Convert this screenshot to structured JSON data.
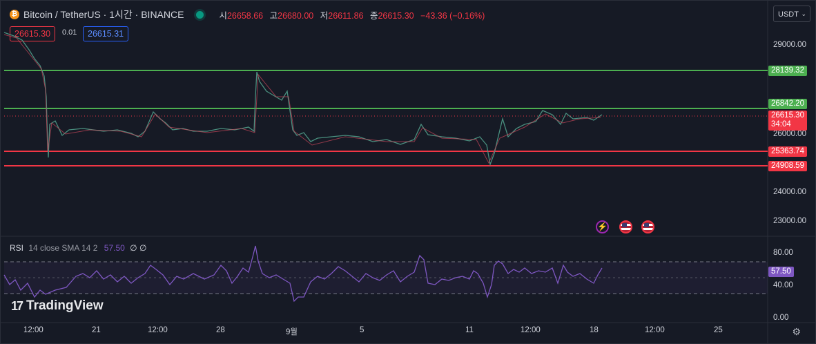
{
  "header": {
    "symbol_title": "Bitcoin / TetherUS · 1시간 · BINANCE",
    "open_label": "시",
    "open": "26658.66",
    "high_label": "고",
    "high": "26680.00",
    "low_label": "저",
    "low": "26611.86",
    "close_label": "종",
    "close": "26615.30",
    "change": "−43.36 (−0.16%)"
  },
  "trade": {
    "sell_price": "26615.30",
    "spread": "0.01",
    "buy_price": "26615.31"
  },
  "currency": {
    "label": "USDT"
  },
  "price_axis": {
    "ticks": [
      "29000.00",
      "26000.00",
      "24000.00",
      "23000.00"
    ],
    "levels": [
      {
        "value": "28139.32",
        "color": "#4caf50"
      },
      {
        "value": "26842.20",
        "color": "#4caf50"
      },
      {
        "value": "25363.74",
        "color": "#f23645"
      },
      {
        "value": "24908.59",
        "color": "#f23645"
      }
    ],
    "current_price": "26615.30",
    "countdown": "34:04"
  },
  "rsi": {
    "title": "RSI",
    "params": "14 close SMA 14 2",
    "value": "57.50",
    "na1": "∅",
    "na2": "∅",
    "ticks": [
      "80.00",
      "40.00",
      "0.00"
    ],
    "tag": "57.50"
  },
  "time_axis": {
    "labels": [
      "12:00",
      "21",
      "12:00",
      "28",
      "9월",
      "5",
      "11",
      "12:00",
      "18",
      "12:00",
      "25"
    ]
  },
  "logo": {
    "text": "TradingView"
  },
  "colors": {
    "bg": "#161a25",
    "up": "#089981",
    "down": "#f23645",
    "rsi": "#7e57c2"
  },
  "icons": {
    "events": [
      "lightning-icon",
      "us-flag-icon",
      "us-flag-icon"
    ],
    "settings": "gear-icon"
  }
}
